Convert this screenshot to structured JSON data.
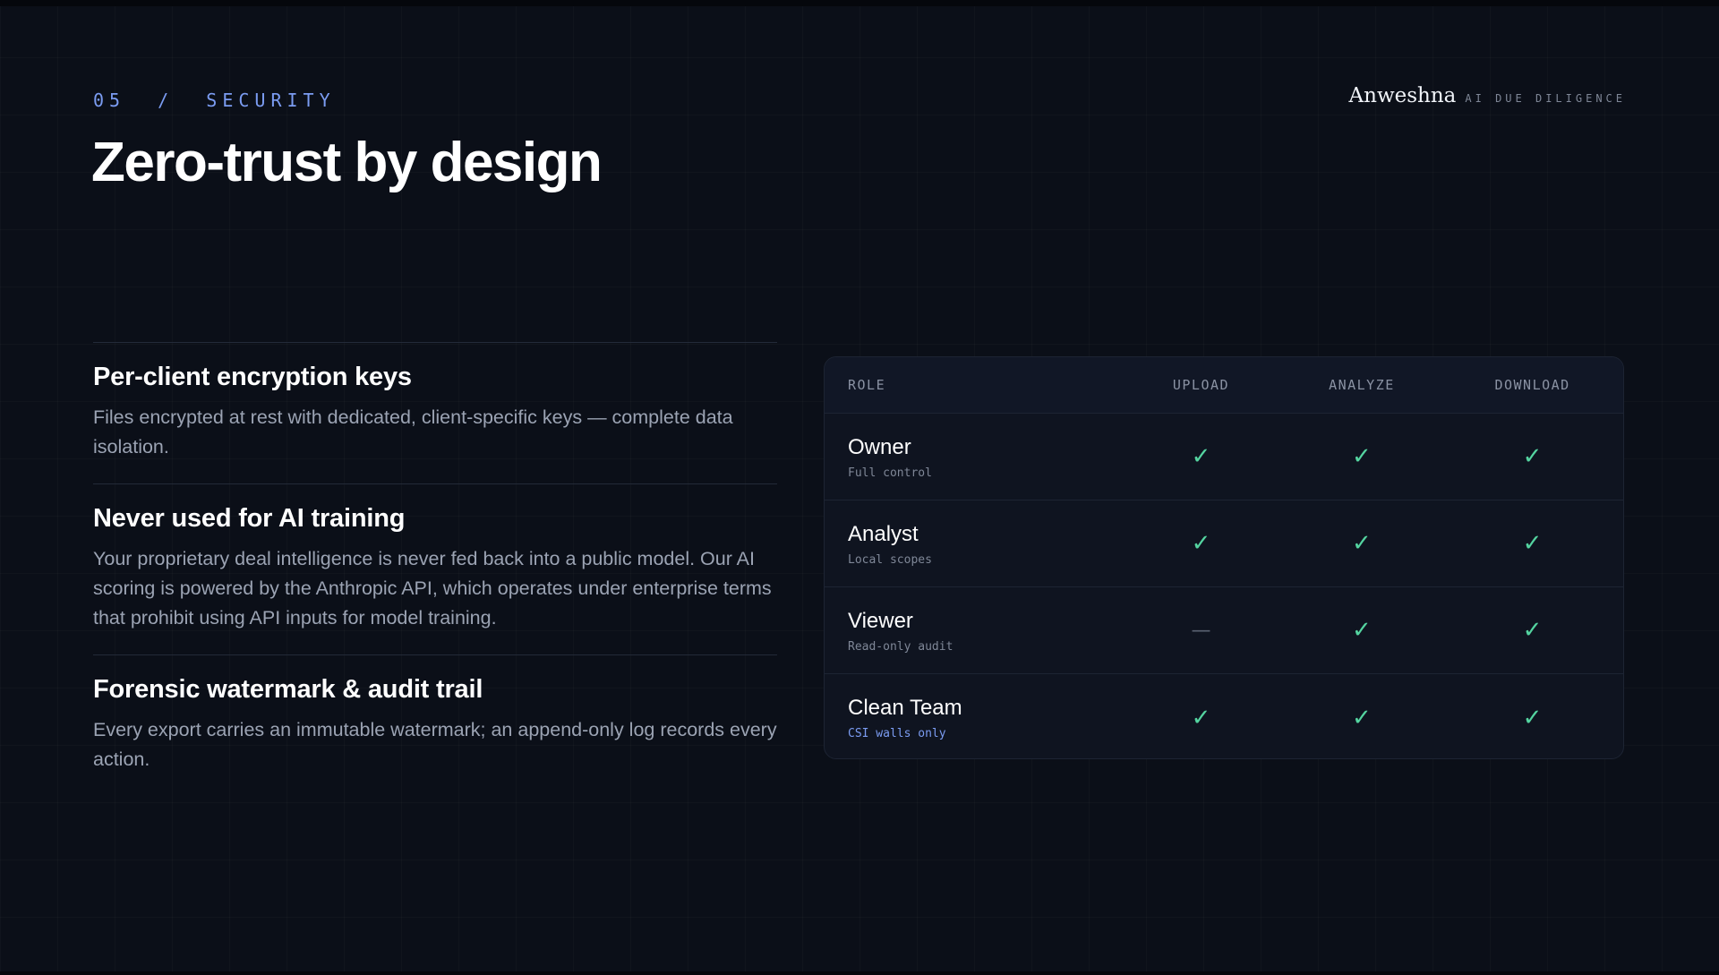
{
  "header": {
    "eyebrow": "05  /  SECURITY",
    "title": "Zero-trust by design",
    "brand_name": "Anweshna",
    "brand_tag": "AI DUE DILIGENCE"
  },
  "features": [
    {
      "title": "Per-client encryption keys",
      "description": "Files encrypted at rest with dedicated, client-specific keys — complete data isolation."
    },
    {
      "title": "Never used for AI training",
      "description": "Your proprietary deal intelligence is never fed back into a public model. Our AI scoring is powered by the Anthropic API, which operates under enterprise terms that prohibit using API inputs for model training."
    },
    {
      "title": "Forensic watermark & audit trail",
      "description": "Every export carries an immutable watermark; an append-only log records every action."
    }
  ],
  "matrix": {
    "headers": [
      "ROLE",
      "UPLOAD",
      "ANALYZE",
      "DOWNLOAD"
    ],
    "rows": [
      {
        "role": "Owner",
        "sub": "Full control",
        "upload": "✓",
        "analyze": "✓",
        "download": "✓"
      },
      {
        "role": "Analyst",
        "sub": "Local scopes",
        "upload": "✓",
        "analyze": "✓",
        "download": "✓"
      },
      {
        "role": "Viewer",
        "sub": "Read-only audit",
        "upload": "—",
        "analyze": "✓",
        "download": "✓"
      },
      {
        "role": "Clean Team",
        "sub": "CSI walls only",
        "upload": "✓",
        "analyze": "✓",
        "download": "✓"
      }
    ]
  },
  "colors": {
    "background": "#0b0f18",
    "accent": "#7b9cf2",
    "check": "#54d4a0"
  }
}
